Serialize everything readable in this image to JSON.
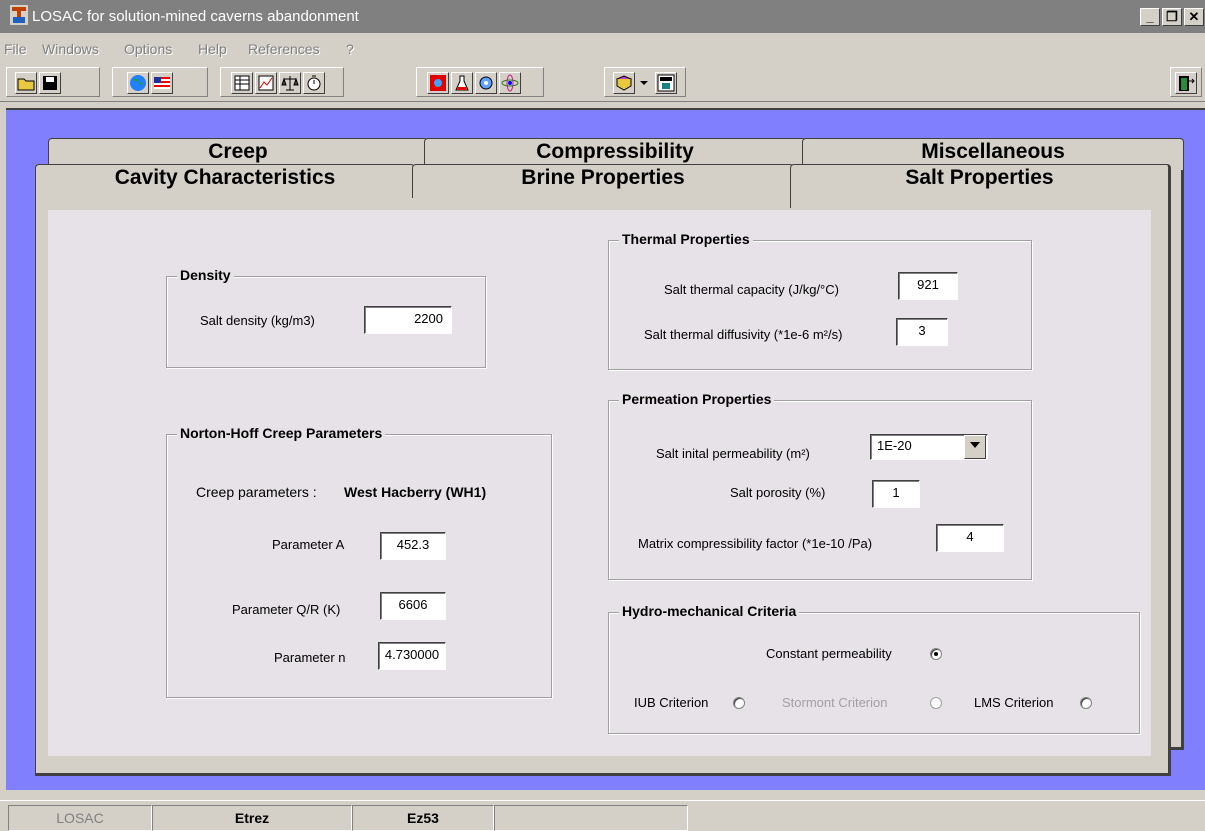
{
  "window": {
    "title": "LOSAC for solution-mined caverns abandonment",
    "minimize": "_",
    "restore": "❐",
    "close": "✕"
  },
  "menu": [
    "File",
    "Windows",
    "Options",
    "Help",
    "References",
    "?"
  ],
  "tabs": {
    "back": [
      "Creep",
      "Compressibility",
      "Miscellaneous"
    ],
    "front": [
      "Cavity Characteristics",
      "Brine Properties",
      "Salt Properties"
    ],
    "active": "Salt Properties"
  },
  "density": {
    "legend": "Density",
    "label": "Salt density (kg/m3)",
    "value": "2200"
  },
  "norton": {
    "legend": "Norton-Hoff Creep Parameters",
    "creep_label": "Creep parameters :",
    "creep_value": "West Hacberry (WH1)",
    "a_label": "Parameter A",
    "a_value": "452.3",
    "qr_label": "Parameter Q/R (K)",
    "qr_value": "6606",
    "n_label": "Parameter n",
    "n_value": "4.730000"
  },
  "thermal": {
    "legend": "Thermal Properties",
    "capacity_label": "Salt thermal capacity (J/kg/°C)",
    "capacity_value": "921",
    "diffusivity_label": "Salt thermal diffusivity (*1e-6 m²/s)",
    "diffusivity_value": "3"
  },
  "permeation": {
    "legend": "Permeation Properties",
    "perm_label": "Salt inital permeability (m²)",
    "perm_value": "1E-20",
    "porosity_label": "Salt porosity (%)",
    "porosity_value": "1",
    "matrix_label": "Matrix compressibility factor (*1e-10 /Pa)",
    "matrix_value": "4"
  },
  "hydro": {
    "legend": "Hydro-mechanical Criteria",
    "constant_label": "Constant permeability",
    "iub_label": "IUB Criterion",
    "stormont_label": "Stormont Criterion",
    "lms_label": "LMS Criterion",
    "selected": "Constant permeability"
  },
  "status": [
    "LOSAC",
    "Etrez",
    "Ez53",
    ""
  ],
  "icons": [
    "app-icon",
    "open-folder-icon",
    "save-disk-icon",
    "globe-icon",
    "us-flag-icon",
    "table-icon",
    "chart-icon",
    "scales-icon",
    "stopwatch-icon",
    "red-square-icon",
    "flask-icon",
    "gear-icon",
    "atom-icon",
    "book-icon",
    "dropdown-arrow-icon",
    "geostock-icon",
    "exit-door-icon"
  ]
}
